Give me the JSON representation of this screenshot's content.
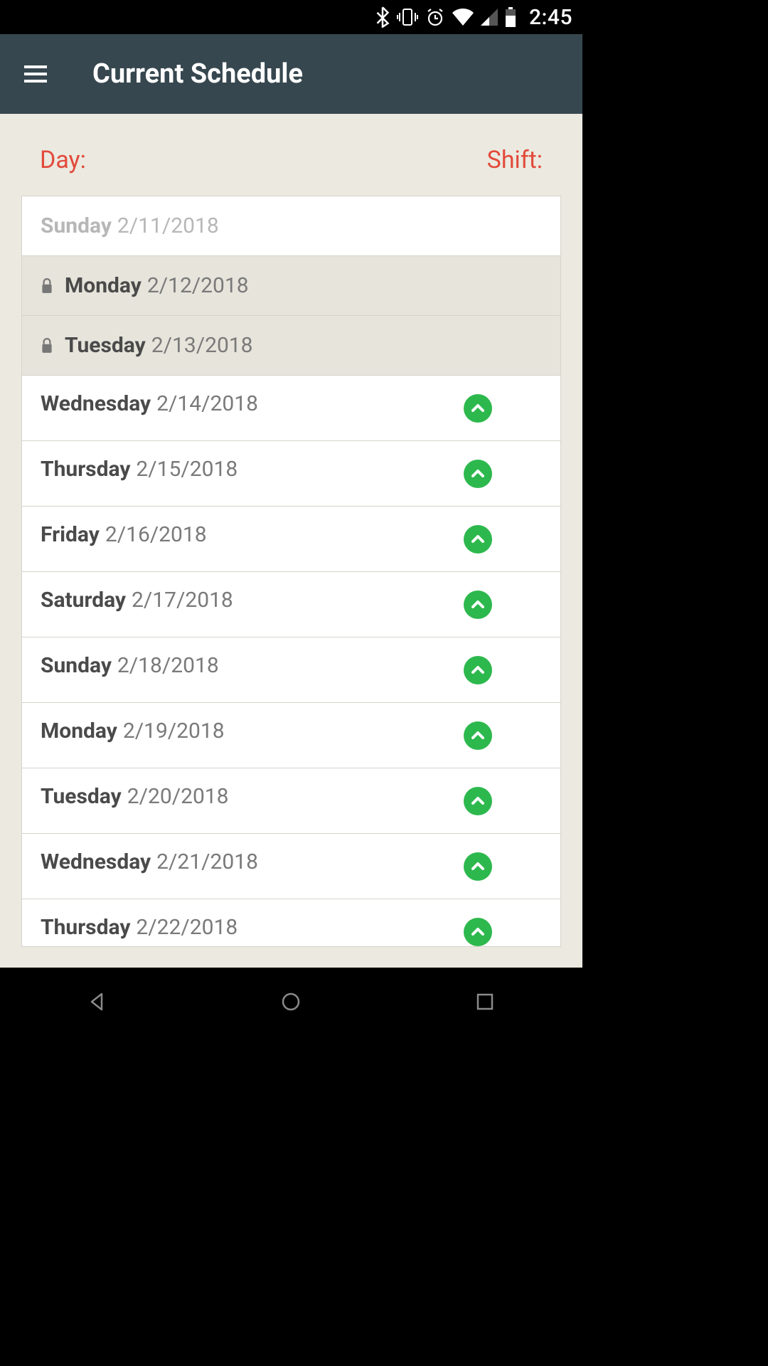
{
  "status": {
    "time": "2:45"
  },
  "appbar": {
    "title": "Current Schedule"
  },
  "headers": {
    "day": "Day:",
    "shift": "Shift:"
  },
  "rows": [
    {
      "dayname": "Sunday",
      "date": "2/11/2018",
      "state": "faded",
      "locked": false,
      "shift": false
    },
    {
      "dayname": "Monday",
      "date": "2/12/2018",
      "state": "locked",
      "locked": true,
      "shift": false
    },
    {
      "dayname": "Tuesday",
      "date": "2/13/2018",
      "state": "locked",
      "locked": true,
      "shift": false
    },
    {
      "dayname": "Wednesday",
      "date": "2/14/2018",
      "state": "normal",
      "locked": false,
      "shift": true
    },
    {
      "dayname": "Thursday",
      "date": "2/15/2018",
      "state": "normal",
      "locked": false,
      "shift": true
    },
    {
      "dayname": "Friday",
      "date": "2/16/2018",
      "state": "normal",
      "locked": false,
      "shift": true
    },
    {
      "dayname": "Saturday",
      "date": "2/17/2018",
      "state": "normal",
      "locked": false,
      "shift": true
    },
    {
      "dayname": "Sunday",
      "date": "2/18/2018",
      "state": "normal",
      "locked": false,
      "shift": true
    },
    {
      "dayname": "Monday",
      "date": "2/19/2018",
      "state": "normal",
      "locked": false,
      "shift": true
    },
    {
      "dayname": "Tuesday",
      "date": "2/20/2018",
      "state": "normal",
      "locked": false,
      "shift": true
    },
    {
      "dayname": "Wednesday",
      "date": "2/21/2018",
      "state": "normal",
      "locked": false,
      "shift": true
    },
    {
      "dayname": "Thursday",
      "date": "2/22/2018",
      "state": "normal",
      "locked": false,
      "shift": true,
      "cut": true
    }
  ]
}
